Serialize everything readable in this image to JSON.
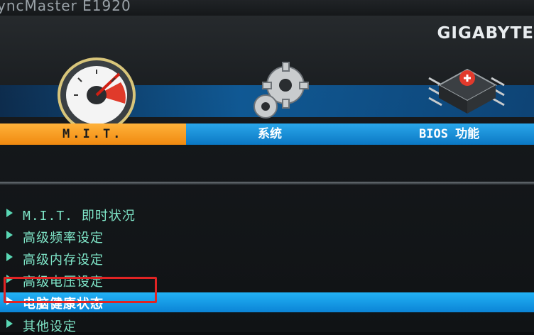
{
  "monitor": {
    "model_text": "yncMaster E1920"
  },
  "bios": {
    "brand": "GIGABYTE",
    "tabs": [
      {
        "label": "M.I.T.",
        "icon": "speedometer-icon",
        "active": true
      },
      {
        "label": "系统",
        "icon": "gears-icon",
        "active": false
      },
      {
        "label": "BIOS 功能",
        "icon": "chip-icon",
        "active": false
      }
    ],
    "menu": [
      {
        "label": "M.I.T. 即时状况",
        "selected": false
      },
      {
        "label": "高级频率设定",
        "selected": false
      },
      {
        "label": "高级内存设定",
        "selected": false
      },
      {
        "label": "高级电压设定",
        "selected": false
      },
      {
        "label": "电脑健康状态",
        "selected": true
      },
      {
        "label": "其他设定",
        "selected": false
      }
    ]
  },
  "colors": {
    "active_tab": "#f08a10",
    "tab_bar": "#1a95de",
    "menu_text": "#7fe6c8",
    "selection_bar": "#149be8",
    "annotation_box": "#e02424"
  }
}
